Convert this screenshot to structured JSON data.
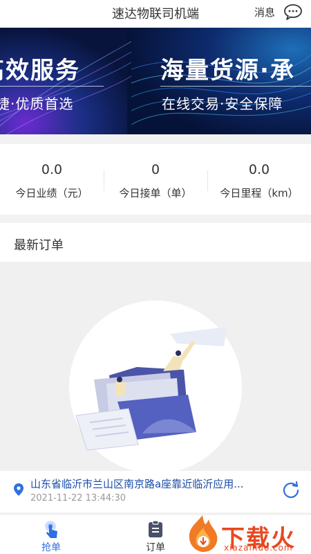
{
  "header": {
    "title": "速达物联司机端",
    "message_label": "消息"
  },
  "banner": {
    "slide_a": {
      "headline": "高效服务",
      "subline": "捷·优质首选"
    },
    "slide_b": {
      "headline": "海量货源·承",
      "subline": "在线交易·安全保障"
    }
  },
  "stats": [
    {
      "value": "0.0",
      "label": "今日业绩（元）"
    },
    {
      "value": "0",
      "label": "今日接单（单）"
    },
    {
      "value": "0.0",
      "label": "今日里程（km）"
    }
  ],
  "orders": {
    "title": "最新订单"
  },
  "location": {
    "address": "山东省临沂市兰山区南京路a座靠近临沂应用...",
    "time": "2021-11-22 13:44:30"
  },
  "tabbar": {
    "grab_label": "抢单",
    "orders_label": "订单"
  },
  "watermark": {
    "text": "下载火",
    "sub": "xiazaihuo.com"
  },
  "colors": {
    "accent": "#2f6fe0",
    "address": "#1a4ba8",
    "watermark": "#e8481e",
    "banner_bg": "#0a1a4a"
  }
}
